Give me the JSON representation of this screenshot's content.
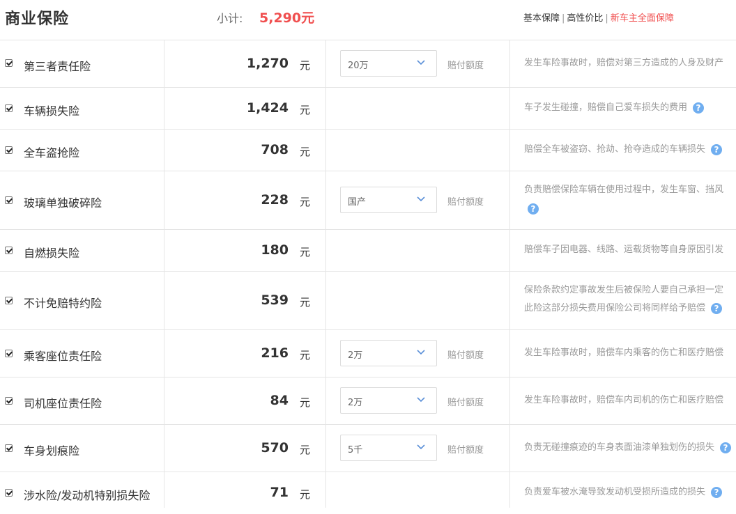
{
  "header": {
    "title": "商业保险",
    "subtotal_label": "小计:",
    "subtotal_value": "5,290元",
    "presets": [
      "基本保障",
      "高性价比",
      "新车主全面保障"
    ],
    "preset_separator": "|"
  },
  "colors": {
    "accent_red": "#f04f4f",
    "help_blue": "#70aef0"
  },
  "unit": "元",
  "amount_label": "赔付额度",
  "help_glyph": "?",
  "rows": [
    {
      "name": "第三者责任险",
      "price": "1,270",
      "select": "20万",
      "desc": "发生车险事故时，赔偿对第三方造成的人身及财产",
      "desc2": ""
    },
    {
      "name": "车辆损失险",
      "price": "1,424",
      "select": "",
      "desc": "车子发生碰撞，赔偿自己爱车损失的费用",
      "desc2": ""
    },
    {
      "name": "全车盗抢险",
      "price": "708",
      "select": "",
      "desc": "赔偿全车被盗窃、抢劫、抢夺造成的车辆损失",
      "desc2": ""
    },
    {
      "name": "玻璃单独破碎险",
      "price": "228",
      "select": "国产",
      "desc": "负责赔偿保险车辆在使用过程中，发生车窗、挡风",
      "desc2": ""
    },
    {
      "name": "自燃损失险",
      "price": "180",
      "select": "",
      "desc": "赔偿车子因电器、线路、运载货物等自身原因引发",
      "desc2": ""
    },
    {
      "name": "不计免赔特约险",
      "price": "539",
      "select": "",
      "desc": "保险条款约定事故发生后被保险人要自己承担一定",
      "desc2": "此险这部分损失费用保险公司将同样给予赔偿"
    },
    {
      "name": "乘客座位责任险",
      "price": "216",
      "select": "2万",
      "desc": "发生车险事故时，赔偿车内乘客的伤亡和医疗赔偿",
      "desc2": ""
    },
    {
      "name": "司机座位责任险",
      "price": "84",
      "select": "2万",
      "desc": "发生车险事故时，赔偿车内司机的伤亡和医疗赔偿",
      "desc2": ""
    },
    {
      "name": "车身划痕险",
      "price": "570",
      "select": "5千",
      "desc": "负责无碰撞痕迹的车身表面油漆单独划伤的损失",
      "desc2": ""
    },
    {
      "name": "涉水险/发动机特别损失险",
      "price": "71",
      "select": "",
      "desc": "负责爱车被水淹导致发动机受损所造成的损失",
      "desc2": ""
    }
  ]
}
